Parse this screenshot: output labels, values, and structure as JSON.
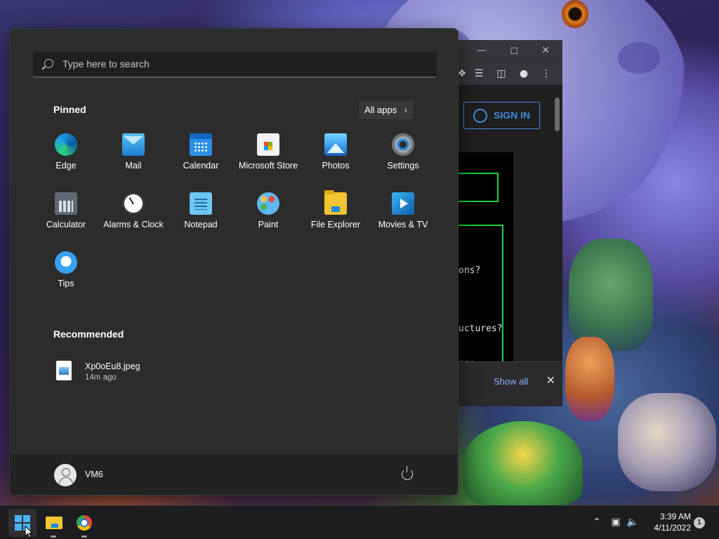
{
  "start_menu": {
    "search_placeholder": "Type here to search",
    "pinned_title": "Pinned",
    "all_apps_label": "All apps",
    "pinned_apps": [
      {
        "label": "Edge",
        "icon": "edge-icon"
      },
      {
        "label": "Mail",
        "icon": "mail-icon"
      },
      {
        "label": "Calendar",
        "icon": "calendar-icon"
      },
      {
        "label": "Microsoft Store",
        "icon": "store-icon"
      },
      {
        "label": "Photos",
        "icon": "photos-icon"
      },
      {
        "label": "Settings",
        "icon": "settings-icon"
      },
      {
        "label": "Calculator",
        "icon": "calculator-icon"
      },
      {
        "label": "Alarms & Clock",
        "icon": "clock-icon"
      },
      {
        "label": "Notepad",
        "icon": "notepad-icon"
      },
      {
        "label": "Paint",
        "icon": "paint-icon"
      },
      {
        "label": "File Explorer",
        "icon": "file-explorer-icon"
      },
      {
        "label": "Movies & TV",
        "icon": "movies-icon"
      },
      {
        "label": "Tips",
        "icon": "tips-icon"
      }
    ],
    "recommended_title": "Recommended",
    "recommended": [
      {
        "name": "Xp0oEu8.jpeg",
        "time": "14m ago",
        "icon": "image-file-icon"
      }
    ],
    "user_name": "VM6"
  },
  "browser": {
    "sign_in_label": "SIGN IN",
    "terminal_lines": [
      "ons?",
      "uctures?",
      "age"
    ],
    "show_all_label": "Show all"
  },
  "taskbar": {
    "time": "3:39 AM",
    "date": "4/11/2022",
    "notification_count": "1"
  },
  "colors": {
    "accent": "#4cc2ff",
    "start_bg": "#2c2c2c",
    "terminal_green": "#1ed13d",
    "link_blue": "#3e8ad8"
  }
}
